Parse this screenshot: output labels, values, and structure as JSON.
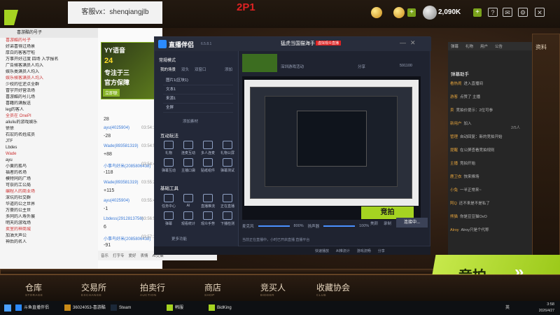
{
  "overlay": {
    "cs_label": "客服vx：shenqiangjlb",
    "p2": "2P1"
  },
  "topbar": {
    "coins": "2,090K",
    "coin_plus": "+",
    "icons": [
      "help-icon",
      "mail-icon",
      "settings-icon"
    ],
    "resources": "资料"
  },
  "left_panel": {
    "title": "喜游酷的号子",
    "rows": [
      "喜游酷的号子",
      "好弟喜得过场景",
      "厚白的客客厅啦",
      "万事开好过度 四场 入学报名",
      "广告候客满员人均入",
      "娱乐类满员人均入",
      "娱乐候客满员人均入",
      "少校的往逆点全群",
      "冒宇开好营活场",
      "喜游酷的号儿场",
      "喜籍的满报送",
      "leg的客人",
      "全员在 OnePI",
      "aliuliu的游戏娱乐",
      "徐徐",
      "石宏的名姓成员",
      "JTF",
      "Lbdes",
      "Wade",
      "ayu",
      "小黄的孤鸟",
      "福者的名场",
      "模特同的广场",
      "可奈的工公局",
      "编程人的商业场",
      "深坑的社交群",
      "华道的公之世界",
      "万豪的公主世",
      "多同的人寿外展",
      "明天的游戏场",
      "卖室的神商城",
      "加油大声公",
      "神后的名人"
    ]
  },
  "chat": {
    "count_top": "28",
    "messages": [
      {
        "user": "ayu(4025904)",
        "time": "03:54:18",
        "text": "-28"
      },
      {
        "user": "Wade(893581319)",
        "time": "03:54:58",
        "text": "+88"
      },
      {
        "user": "小事鸟好米(2085806438)",
        "time": "03:54:42",
        "text": "-118"
      },
      {
        "user": "Wade(893581319)",
        "time": "03:55:28",
        "text": "+115"
      },
      {
        "user": "ayu(4025904)",
        "time": "03:55:45",
        "text": "-1"
      },
      {
        "user": "Lbdess(2912813756)",
        "time": "03:56:55",
        "text": "6"
      },
      {
        "user": "小事鸟好米(2085806438)",
        "time": "03:57:17",
        "text": "-91"
      }
    ],
    "bottom_bar": [
      "音乐",
      "打字专",
      "爱好",
      "表情",
      "AI交集"
    ]
  },
  "yy": {
    "brand": "YY语音",
    "line1": "专注于三",
    "line2": "官方保障",
    "badge": "24",
    "btn": "立即联"
  },
  "streamer": {
    "title": "直播伴侣",
    "version": "6.5.8.1",
    "top_user": "猛虎当国猫海手",
    "top_tag": "虚拟观众直播",
    "top_sub": "深圳游戏活动",
    "share": "分享",
    "online": "直播在线",
    "fans": "591100",
    "mode": "常规模式",
    "scenes_tab": "我的场景",
    "scene_tabs": [
      "我的场景",
      "双头",
      "双窗口"
    ],
    "add": "添加",
    "sources": [
      "图片1(区块1)",
      "文本1",
      "来源1",
      "全屏"
    ],
    "add_source": "添加素材",
    "section1": "互动玩法",
    "tools1": [
      "礼物",
      "连麦互动",
      "多人连麦",
      "礼物公屏",
      "弹幕互动",
      "主播口袋",
      "贴纸组件",
      "弹幕测试"
    ],
    "section2": "基础工具",
    "tools2": [
      "任务中心",
      "AI",
      "直播推流",
      "正在直播",
      "弹幕",
      "观看统计",
      "观众手势",
      "下播检测"
    ],
    "more": "更多功能",
    "mic": "麦克风",
    "mic_val": "800%",
    "spk": "扬声器",
    "spk_val": "100%",
    "ctrl": [
      "美颜",
      "录制",
      "设置"
    ],
    "connect": "连接中...",
    "hint": "当前正在直播中，小时已开启直播 直播平台",
    "bid": "竞拍",
    "status": [
      "快速播放",
      "AI推流计",
      "游戏流畅",
      "分享"
    ],
    "stats": "0.0% | 0.0% | 0fps | 0% 0k | 0.0%"
  },
  "right_panel": {
    "tabs": [
      "弹幕",
      "礼物",
      "用户",
      "公告"
    ],
    "title": "弹幕助手",
    "msgs": [
      {
        "n": "看热闹",
        "t": "进入直播间"
      },
      {
        "n": "游客",
        "t": "点赞了 主播"
      },
      {
        "n": "卖",
        "t": "竞拍价提示：2位可参"
      },
      {
        "n": "新用户",
        "t": "加入"
      },
      {
        "n": "管理",
        "t": "自动回复：新的竞拍开始"
      },
      {
        "n": "提醒",
        "t": "在公屏查看竞拍规则"
      },
      {
        "n": "主播",
        "t": "竞拍开始"
      },
      {
        "n": "鹿卫衣",
        "t": "快来捧场"
      },
      {
        "n": "小兔",
        "t": "一半正常来~"
      },
      {
        "n": "阿Q",
        "t": "还不来是不是私了"
      },
      {
        "n": "熊猫",
        "t": "你是豆豆猫OvO"
      },
      {
        "n": "Alroy",
        "t": "Alroy只是个代称"
      }
    ],
    "count": "2/5人"
  },
  "bid_button": "竞拍",
  "bottom_nav": [
    {
      "label": "仓库",
      "sub": "STORAGE"
    },
    {
      "label": "交易所",
      "sub": "EXCHANGE"
    },
    {
      "label": "拍卖行",
      "sub": "AUCTION"
    },
    {
      "label": "商店",
      "sub": "SHOP"
    },
    {
      "label": "竞买人",
      "sub": "BIDDER"
    },
    {
      "label": "收藏协会",
      "sub": "CLUB"
    }
  ],
  "taskbar": {
    "items": [
      "斗鱼直播伴侣",
      "36024053-喜游酷",
      "Steam",
      "韩服",
      "BidKing"
    ],
    "time": "3:58",
    "date": "2026/4/27",
    "lang": "英"
  }
}
